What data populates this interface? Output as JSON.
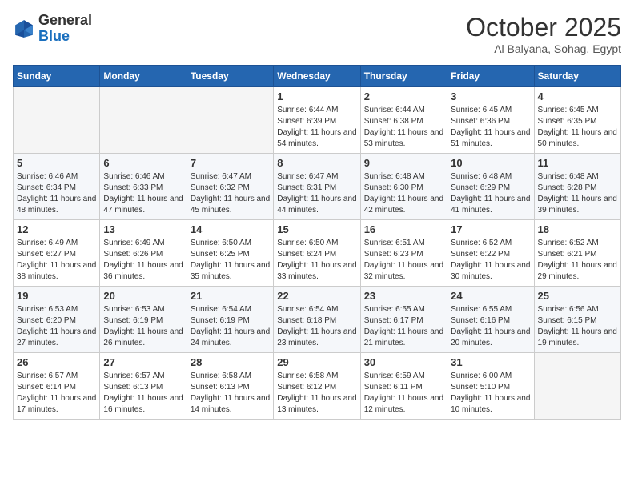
{
  "header": {
    "logo_general": "General",
    "logo_blue": "Blue",
    "month_title": "October 2025",
    "location": "Al Balyana, Sohag, Egypt"
  },
  "days_of_week": [
    "Sunday",
    "Monday",
    "Tuesday",
    "Wednesday",
    "Thursday",
    "Friday",
    "Saturday"
  ],
  "weeks": [
    [
      {
        "day": "",
        "sunrise": "",
        "sunset": "",
        "daylight": "",
        "empty": true
      },
      {
        "day": "",
        "sunrise": "",
        "sunset": "",
        "daylight": "",
        "empty": true
      },
      {
        "day": "",
        "sunrise": "",
        "sunset": "",
        "daylight": "",
        "empty": true
      },
      {
        "day": "1",
        "sunrise": "Sunrise: 6:44 AM",
        "sunset": "Sunset: 6:39 PM",
        "daylight": "Daylight: 11 hours and 54 minutes."
      },
      {
        "day": "2",
        "sunrise": "Sunrise: 6:44 AM",
        "sunset": "Sunset: 6:38 PM",
        "daylight": "Daylight: 11 hours and 53 minutes."
      },
      {
        "day": "3",
        "sunrise": "Sunrise: 6:45 AM",
        "sunset": "Sunset: 6:36 PM",
        "daylight": "Daylight: 11 hours and 51 minutes."
      },
      {
        "day": "4",
        "sunrise": "Sunrise: 6:45 AM",
        "sunset": "Sunset: 6:35 PM",
        "daylight": "Daylight: 11 hours and 50 minutes."
      }
    ],
    [
      {
        "day": "5",
        "sunrise": "Sunrise: 6:46 AM",
        "sunset": "Sunset: 6:34 PM",
        "daylight": "Daylight: 11 hours and 48 minutes."
      },
      {
        "day": "6",
        "sunrise": "Sunrise: 6:46 AM",
        "sunset": "Sunset: 6:33 PM",
        "daylight": "Daylight: 11 hours and 47 minutes."
      },
      {
        "day": "7",
        "sunrise": "Sunrise: 6:47 AM",
        "sunset": "Sunset: 6:32 PM",
        "daylight": "Daylight: 11 hours and 45 minutes."
      },
      {
        "day": "8",
        "sunrise": "Sunrise: 6:47 AM",
        "sunset": "Sunset: 6:31 PM",
        "daylight": "Daylight: 11 hours and 44 minutes."
      },
      {
        "day": "9",
        "sunrise": "Sunrise: 6:48 AM",
        "sunset": "Sunset: 6:30 PM",
        "daylight": "Daylight: 11 hours and 42 minutes."
      },
      {
        "day": "10",
        "sunrise": "Sunrise: 6:48 AM",
        "sunset": "Sunset: 6:29 PM",
        "daylight": "Daylight: 11 hours and 41 minutes."
      },
      {
        "day": "11",
        "sunrise": "Sunrise: 6:48 AM",
        "sunset": "Sunset: 6:28 PM",
        "daylight": "Daylight: 11 hours and 39 minutes."
      }
    ],
    [
      {
        "day": "12",
        "sunrise": "Sunrise: 6:49 AM",
        "sunset": "Sunset: 6:27 PM",
        "daylight": "Daylight: 11 hours and 38 minutes."
      },
      {
        "day": "13",
        "sunrise": "Sunrise: 6:49 AM",
        "sunset": "Sunset: 6:26 PM",
        "daylight": "Daylight: 11 hours and 36 minutes."
      },
      {
        "day": "14",
        "sunrise": "Sunrise: 6:50 AM",
        "sunset": "Sunset: 6:25 PM",
        "daylight": "Daylight: 11 hours and 35 minutes."
      },
      {
        "day": "15",
        "sunrise": "Sunrise: 6:50 AM",
        "sunset": "Sunset: 6:24 PM",
        "daylight": "Daylight: 11 hours and 33 minutes."
      },
      {
        "day": "16",
        "sunrise": "Sunrise: 6:51 AM",
        "sunset": "Sunset: 6:23 PM",
        "daylight": "Daylight: 11 hours and 32 minutes."
      },
      {
        "day": "17",
        "sunrise": "Sunrise: 6:52 AM",
        "sunset": "Sunset: 6:22 PM",
        "daylight": "Daylight: 11 hours and 30 minutes."
      },
      {
        "day": "18",
        "sunrise": "Sunrise: 6:52 AM",
        "sunset": "Sunset: 6:21 PM",
        "daylight": "Daylight: 11 hours and 29 minutes."
      }
    ],
    [
      {
        "day": "19",
        "sunrise": "Sunrise: 6:53 AM",
        "sunset": "Sunset: 6:20 PM",
        "daylight": "Daylight: 11 hours and 27 minutes."
      },
      {
        "day": "20",
        "sunrise": "Sunrise: 6:53 AM",
        "sunset": "Sunset: 6:19 PM",
        "daylight": "Daylight: 11 hours and 26 minutes."
      },
      {
        "day": "21",
        "sunrise": "Sunrise: 6:54 AM",
        "sunset": "Sunset: 6:19 PM",
        "daylight": "Daylight: 11 hours and 24 minutes."
      },
      {
        "day": "22",
        "sunrise": "Sunrise: 6:54 AM",
        "sunset": "Sunset: 6:18 PM",
        "daylight": "Daylight: 11 hours and 23 minutes."
      },
      {
        "day": "23",
        "sunrise": "Sunrise: 6:55 AM",
        "sunset": "Sunset: 6:17 PM",
        "daylight": "Daylight: 11 hours and 21 minutes."
      },
      {
        "day": "24",
        "sunrise": "Sunrise: 6:55 AM",
        "sunset": "Sunset: 6:16 PM",
        "daylight": "Daylight: 11 hours and 20 minutes."
      },
      {
        "day": "25",
        "sunrise": "Sunrise: 6:56 AM",
        "sunset": "Sunset: 6:15 PM",
        "daylight": "Daylight: 11 hours and 19 minutes."
      }
    ],
    [
      {
        "day": "26",
        "sunrise": "Sunrise: 6:57 AM",
        "sunset": "Sunset: 6:14 PM",
        "daylight": "Daylight: 11 hours and 17 minutes."
      },
      {
        "day": "27",
        "sunrise": "Sunrise: 6:57 AM",
        "sunset": "Sunset: 6:13 PM",
        "daylight": "Daylight: 11 hours and 16 minutes."
      },
      {
        "day": "28",
        "sunrise": "Sunrise: 6:58 AM",
        "sunset": "Sunset: 6:13 PM",
        "daylight": "Daylight: 11 hours and 14 minutes."
      },
      {
        "day": "29",
        "sunrise": "Sunrise: 6:58 AM",
        "sunset": "Sunset: 6:12 PM",
        "daylight": "Daylight: 11 hours and 13 minutes."
      },
      {
        "day": "30",
        "sunrise": "Sunrise: 6:59 AM",
        "sunset": "Sunset: 6:11 PM",
        "daylight": "Daylight: 11 hours and 12 minutes."
      },
      {
        "day": "31",
        "sunrise": "Sunrise: 6:00 AM",
        "sunset": "Sunset: 5:10 PM",
        "daylight": "Daylight: 11 hours and 10 minutes."
      },
      {
        "day": "",
        "sunrise": "",
        "sunset": "",
        "daylight": "",
        "empty": true
      }
    ]
  ]
}
